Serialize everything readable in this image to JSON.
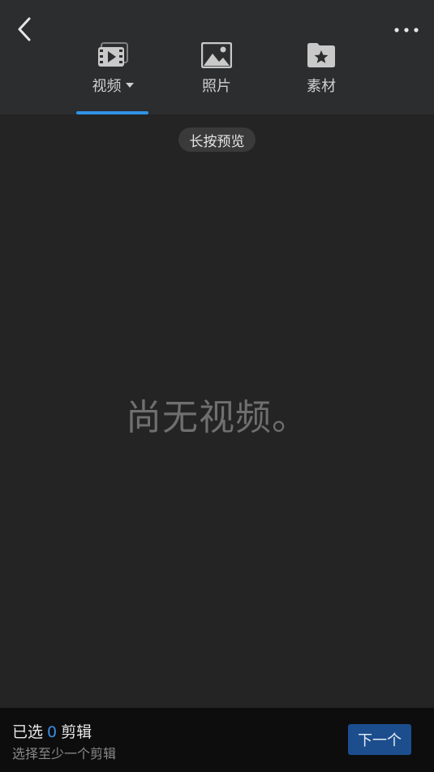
{
  "header": {
    "tabs": [
      {
        "label": "视频",
        "icon": "film-icon",
        "selected": true,
        "has_dropdown": true
      },
      {
        "label": "照片",
        "icon": "image-icon",
        "selected": false
      },
      {
        "label": "素材",
        "icon": "star-folder-icon",
        "selected": false
      }
    ],
    "back_icon": "chevron-left-icon",
    "more_icon": "more-horizontal-icon"
  },
  "hint": {
    "label": "长按预览"
  },
  "main": {
    "empty_message": "尚无视频。"
  },
  "footer": {
    "selected_prefix": "已选",
    "selected_count": "0",
    "selected_suffix": "剪辑",
    "selection_hint": "选择至少一个剪辑",
    "next_label": "下一个"
  },
  "colors": {
    "accent": "#2f93e4",
    "count": "#3b8ee8",
    "next_button": "#1c4e8e",
    "topbar": "#2c2d2f",
    "background": "#242424",
    "bottombar": "#0d0d0d"
  }
}
